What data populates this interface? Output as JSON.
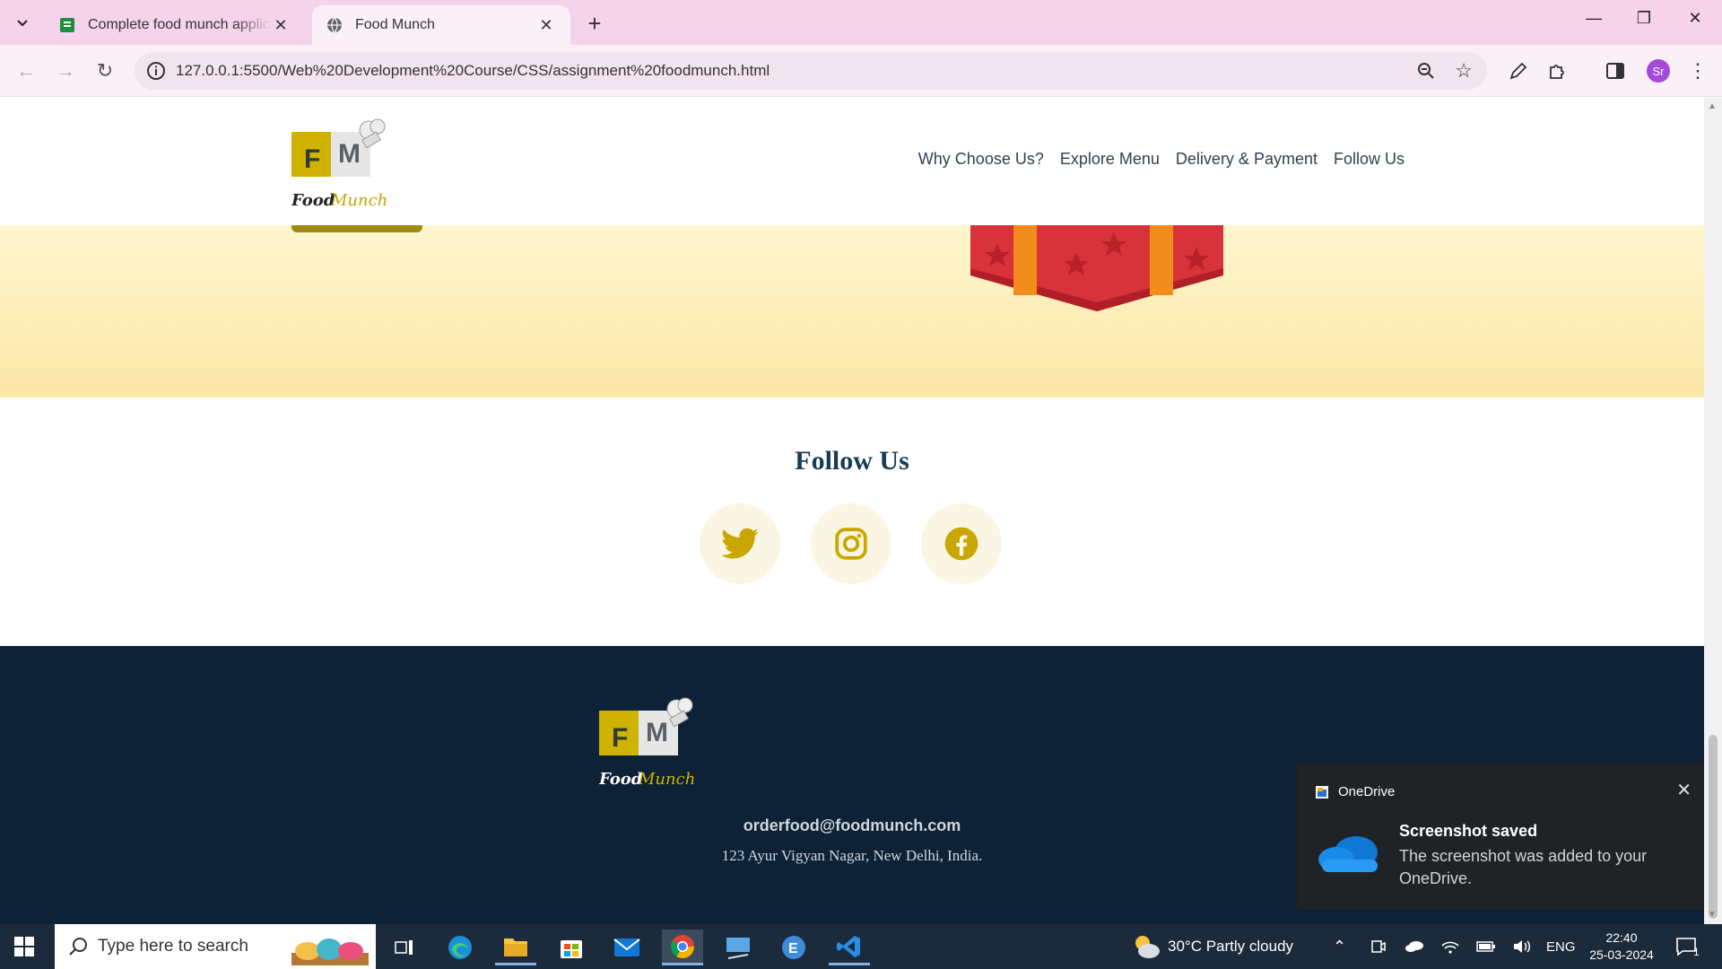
{
  "browser": {
    "tabs": [
      {
        "title": "Complete food munch applicati",
        "active": false
      },
      {
        "title": "Food Munch",
        "active": true
      }
    ],
    "url": "127.0.0.1:5500/Web%20Development%20Course/CSS/assignment%20foodmunch.html",
    "profile_initials": "Sr"
  },
  "site": {
    "logo_text_a": "Food",
    "logo_text_b": "Munch",
    "logo_letter_f": "F",
    "logo_letter_m": "M",
    "nav": [
      "Why Choose Us?",
      "Explore Menu",
      "Delivery & Payment",
      "Follow Us"
    ],
    "follow_title": "Follow Us",
    "social_icons": [
      "twitter-icon",
      "instagram-icon",
      "facebook-icon"
    ],
    "footer_email": "orderfood@foodmunch.com",
    "footer_address": "123 Ayur Vigyan Nagar, New Delhi, India."
  },
  "colors": {
    "brand_yellow": "#d0b200",
    "heading": "#183b56",
    "footer_bg": "#0d2137",
    "social_bg": "#fbf6e4"
  },
  "toast": {
    "app": "OneDrive",
    "title": "Screenshot saved",
    "body": "The screenshot was added to your OneDrive."
  },
  "taskbar": {
    "search_placeholder": "Type here to search",
    "weather": "30°C  Partly cloudy",
    "language": "ENG",
    "time": "22:40",
    "date": "25-03-2024",
    "notification_count": "1"
  }
}
